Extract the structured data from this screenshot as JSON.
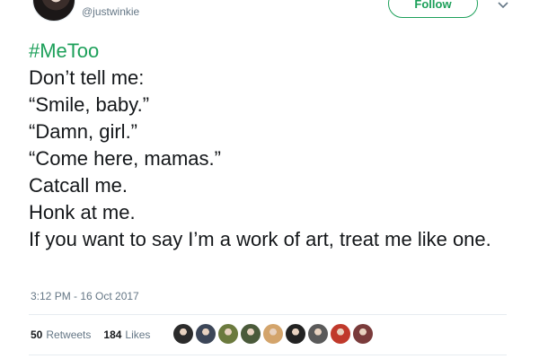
{
  "user": {
    "handle": "@justwinkie"
  },
  "follow_button": {
    "label": "Follow"
  },
  "tweet": {
    "hashtag": "#MeToo",
    "lines": [
      "Don’t tell me:",
      "“Smile, baby.”",
      "“Damn, girl.”",
      "“Come here, mamas.”",
      "Catcall me.",
      "Honk at me.",
      "If you want to say I’m a work of art, treat me like one."
    ],
    "timestamp": "3:12 PM - 16 Oct 2017"
  },
  "stats": {
    "retweets_count": "50",
    "retweets_label": "Retweets",
    "likes_count": "184",
    "likes_label": "Likes"
  },
  "icons": {
    "caret": "chevron-down-icon"
  },
  "colors": {
    "accent": "#1da05a",
    "text": "#14171a",
    "muted": "#657786"
  },
  "likers": [
    {
      "name": "liker-avatar-1",
      "color": "#2b2b2b"
    },
    {
      "name": "liker-avatar-2",
      "color": "#3c4658"
    },
    {
      "name": "liker-avatar-3",
      "color": "#6b7a3e"
    },
    {
      "name": "liker-avatar-4",
      "color": "#4a5a3a"
    },
    {
      "name": "liker-avatar-5",
      "color": "#d3a46b"
    },
    {
      "name": "liker-avatar-6",
      "color": "#222222"
    },
    {
      "name": "liker-avatar-7",
      "color": "#5a5a5a"
    },
    {
      "name": "liker-avatar-8",
      "color": "#c0392b"
    },
    {
      "name": "liker-avatar-9",
      "color": "#7a3b3b"
    }
  ]
}
